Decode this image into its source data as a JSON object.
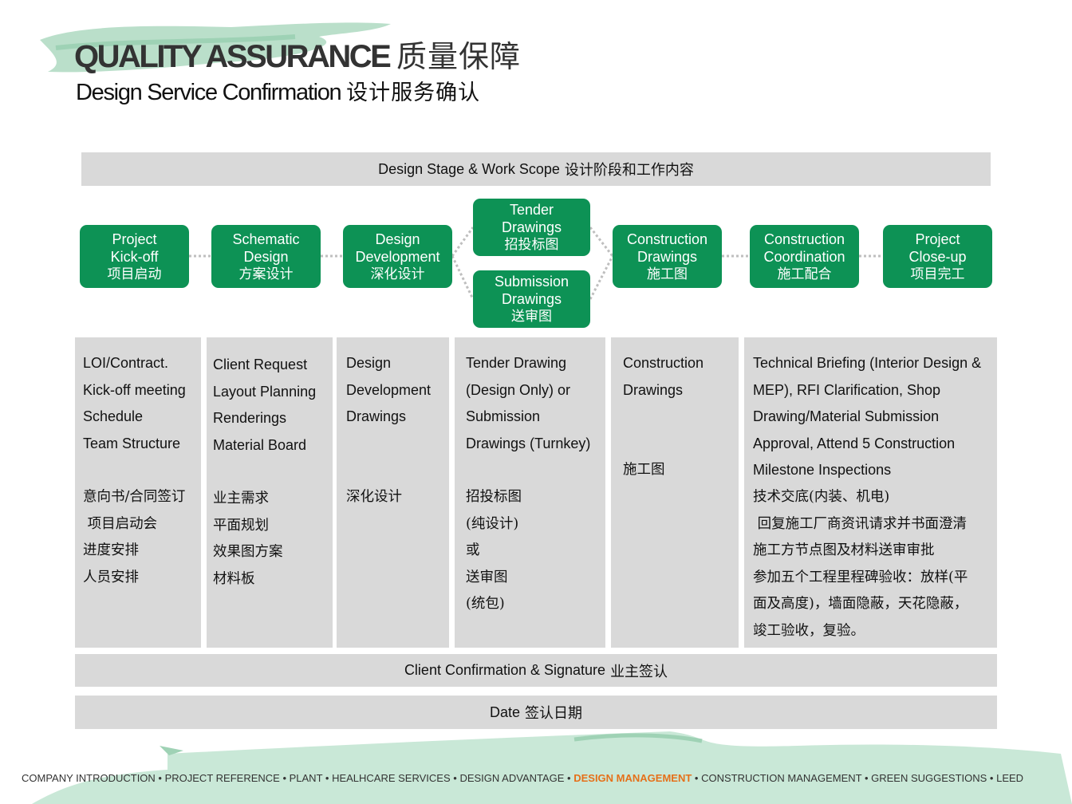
{
  "title": {
    "en": "QUALITY ASSURANCE",
    "cn": "质量保障"
  },
  "subtitle": {
    "en": "Design Service Confirmation",
    "cn": "设计服务确认"
  },
  "stage_bar": {
    "en": "Design Stage & Work Scope",
    "cn": "设计阶段和工作内容"
  },
  "stages": [
    {
      "l1": "Project",
      "l2": "Kick-off",
      "cn": "项目启动"
    },
    {
      "l1": "Schematic",
      "l2": "Design",
      "cn": "方案设计"
    },
    {
      "l1": "Design",
      "l2": "Development",
      "cn": "深化设计"
    },
    {
      "l1": "Tender",
      "l2": "Drawings",
      "cn": "招投标图"
    },
    {
      "l1": "Submission",
      "l2": "Drawings",
      "cn": "送审图"
    },
    {
      "l1": "Construction",
      "l2": "Drawings",
      "cn": "施工图"
    },
    {
      "l1": "Construction",
      "l2": "Coordination",
      "cn": "施工配合"
    },
    {
      "l1": "Project",
      "l2": "Close-up",
      "cn": "项目完工"
    }
  ],
  "scope": [
    {
      "en": [
        "LOI/Contract.",
        "Kick-off meeting",
        "Schedule",
        "Team Structure"
      ],
      "cn": [
        "意向书/合同签订",
        " 项目启动会",
        "进度安排",
        "人员安排"
      ]
    },
    {
      "en": [
        "Client Request",
        "Layout Planning",
        "Renderings",
        "Material Board"
      ],
      "cn": [
        "业主需求",
        "平面规划",
        "效果图方案",
        "材料板"
      ]
    },
    {
      "en": [
        "Design",
        "Development",
        "Drawings"
      ],
      "cn": [
        "深化设计"
      ]
    },
    {
      "en": [
        "Tender Drawing",
        "(Design Only) or",
        "Submission",
        "Drawings (Turnkey)"
      ],
      "cn": [
        "招投标图",
        "(纯设计)",
        "或",
        "送审图",
        "(统包)"
      ]
    },
    {
      "en": [
        "Construction",
        "Drawings"
      ],
      "cn": [
        "施工图"
      ]
    },
    {
      "en": [
        "Technical Briefing (Interior Design &",
        "MEP), RFI Clarification, Shop",
        "Drawing/Material Submission",
        "Approval, Attend 5 Construction",
        "Milestone Inspections"
      ],
      "cn": [
        "技术交底(内装、机电)",
        " 回复施工厂商资讯请求并书面澄清",
        "施工方节点图及材料送审审批",
        "参加五个工程里程碑验收：放样(平",
        "面及高度)，墙面隐蔽，天花隐蔽，",
        "竣工验收，复验。"
      ]
    }
  ],
  "confirm_bar": {
    "en": "Client Confirmation & Signature",
    "cn": "业主签认"
  },
  "date_bar": {
    "en": "Date",
    "cn": "签认日期"
  },
  "footer": {
    "items": [
      "COMPANY INTRODUCTION",
      "PROJECT REFERENCE",
      "PLANT",
      "HEALHCARE SERVICES",
      "DESIGN ADVANTAGE",
      "DESIGN MANAGEMENT",
      "CONSTRUCTION MANAGEMENT",
      "GREEN SUGGESTIONS",
      "LEED"
    ],
    "separator": " • ",
    "active": "DESIGN MANAGEMENT"
  },
  "colors": {
    "accent_green": "#0d9255",
    "panel_gray": "#d9d9d9",
    "active_nav": "#e5701a",
    "brush_green": "#a9d7bd"
  }
}
